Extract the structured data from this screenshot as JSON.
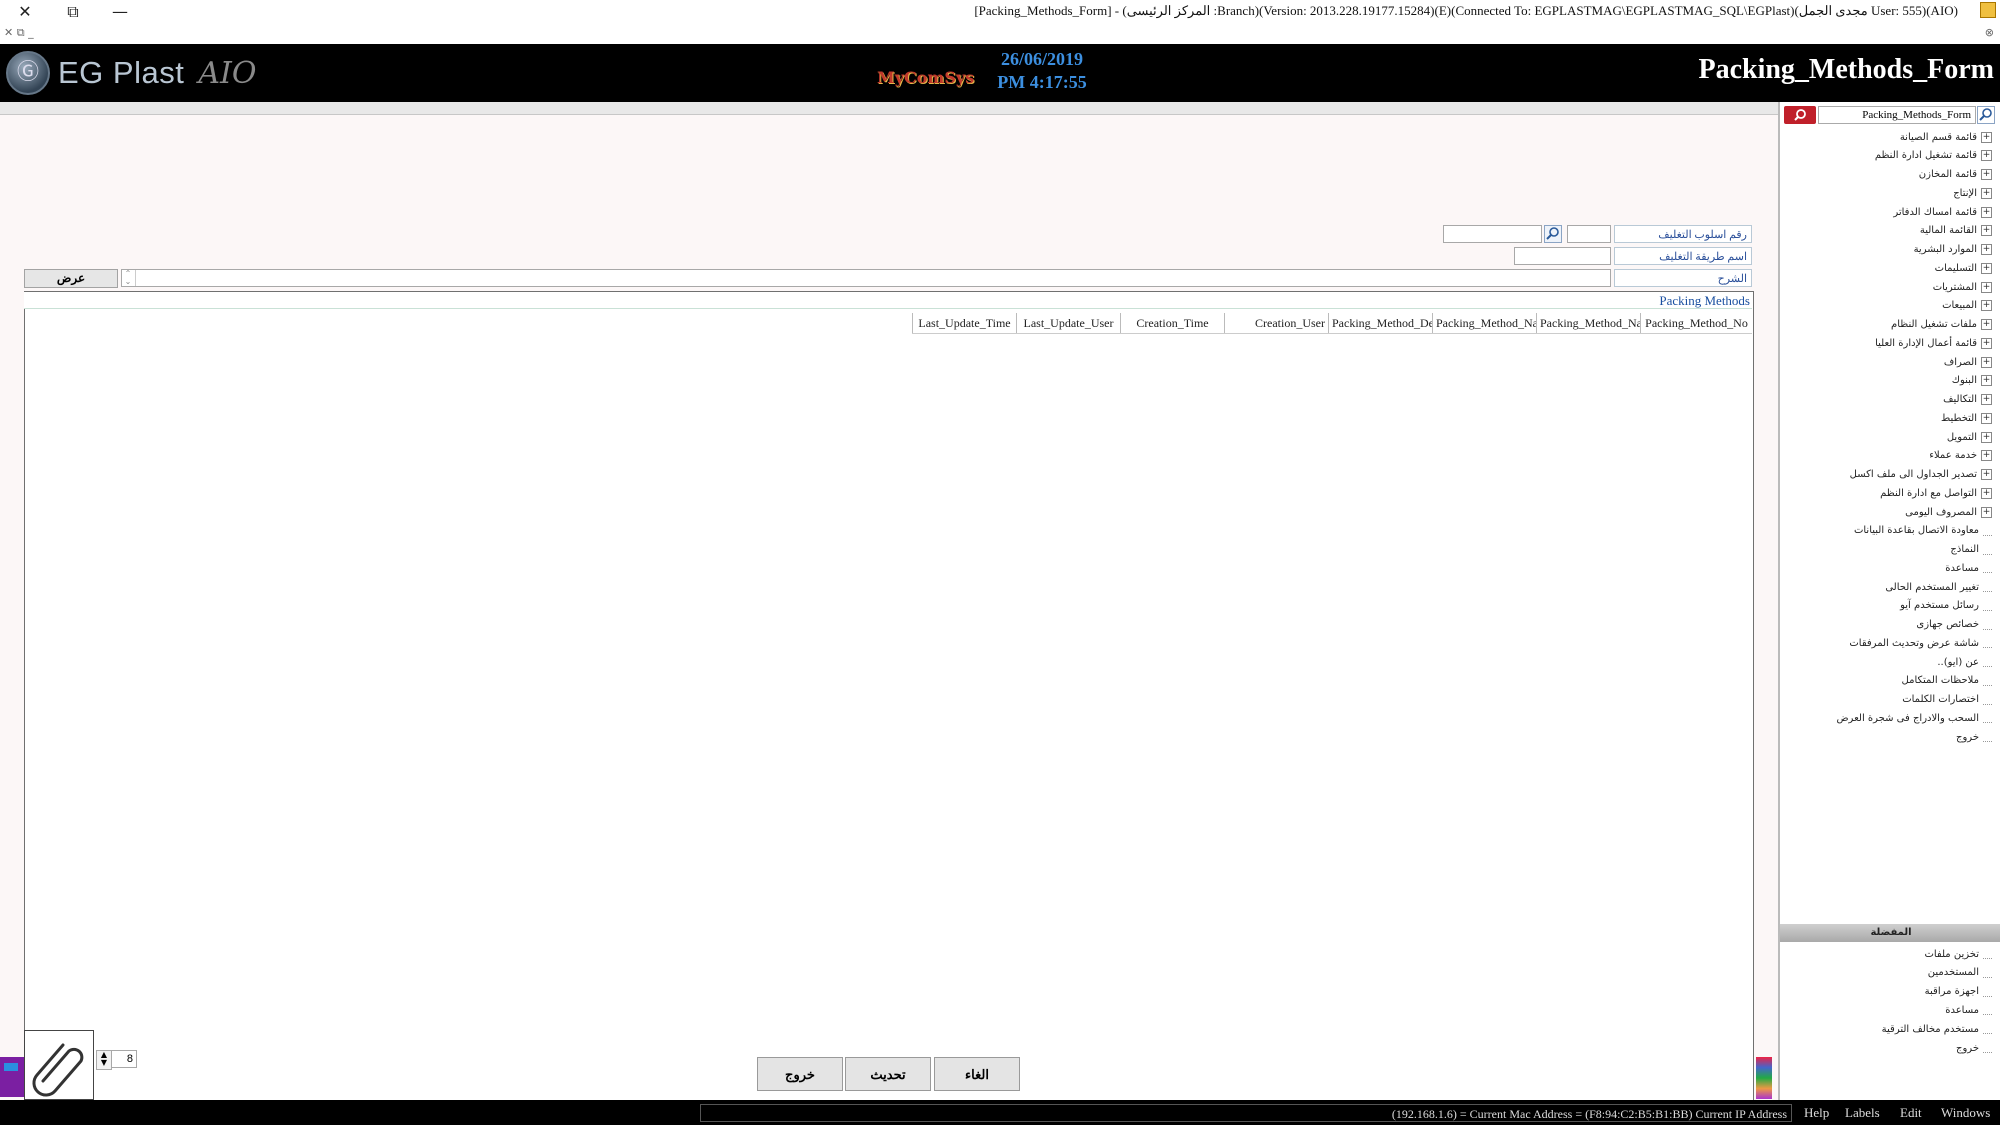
{
  "window": {
    "title": "[Packing_Methods_Form] - (المركز الرئيسى :Branch)(Version: 2013.228.19177.15284)(E)(Connected To: EGPLASTMAG\\EGPLASTMAG_SQL\\EGPlast)(مجدى الجمل User: 555)(AIO)",
    "close_glyph": "✕",
    "restore_glyph": "⧉",
    "minimize_glyph": "—",
    "mdi_controls": "✕ ⧉ _",
    "mdi_right": "⊗"
  },
  "header": {
    "brand_name": "EG Plast",
    "brand_suffix": "AIO",
    "logo_glyph": "Ⓖ",
    "company_mark": "MyComSys",
    "date": "26/06/2019",
    "time": "PM 4:17:55",
    "form_title": "Packing_Methods_Form"
  },
  "form": {
    "label_method_no": "رقم اسلوب التغليف",
    "label_method_name": "اسم طريقة التغليف",
    "label_description": "الشرح",
    "method_no_value": "",
    "method_name_value": "",
    "description_value": "",
    "show_button": "عرض"
  },
  "grid": {
    "caption": "Packing Methods",
    "columns": [
      "Packing_Method_No",
      "Packing_Method_Name",
      "Packing_Method_Name",
      "Packing_Method_Description",
      "Creation_User",
      "Creation_Time",
      "Last_Update_User",
      "Last_Update_Time"
    ]
  },
  "footer": {
    "cancel_button": "الغاء",
    "update_button": "تحديث",
    "exit_button": "خروج",
    "attachment_count": "8"
  },
  "sidebar": {
    "search_value": "Packing_Methods_Form",
    "tree": [
      {
        "label": "قائمة قسم الصيانة",
        "expandable": true
      },
      {
        "label": "قائمة تشغيل ادارة النظم",
        "expandable": true
      },
      {
        "label": "قائمة المخازن",
        "expandable": true
      },
      {
        "label": "الإنتاج",
        "expandable": true
      },
      {
        "label": "قائمة امساك الدفاتر",
        "expandable": true
      },
      {
        "label": "القائمة المالية",
        "expandable": true
      },
      {
        "label": "الموارد البشرية",
        "expandable": true
      },
      {
        "label": "التسليمات",
        "expandable": true
      },
      {
        "label": "المشتريات",
        "expandable": true
      },
      {
        "label": "المبيعات",
        "expandable": true
      },
      {
        "label": "ملفات تشغيل النظام",
        "expandable": true
      },
      {
        "label": "قائمة أعمال الإدارة العليا",
        "expandable": true
      },
      {
        "label": "الصراف",
        "expandable": true
      },
      {
        "label": "البنوك",
        "expandable": true
      },
      {
        "label": "التكاليف",
        "expandable": true
      },
      {
        "label": "التخطيط",
        "expandable": true
      },
      {
        "label": "التمويل",
        "expandable": true
      },
      {
        "label": "خدمة عملاء",
        "expandable": true
      },
      {
        "label": "تصدير الجداول الى ملف اكسل",
        "expandable": true
      },
      {
        "label": "التواصل مع ادارة النظم",
        "expandable": true
      },
      {
        "label": "المصروف اليومى",
        "expandable": true
      },
      {
        "label": "معاودة الاتصال بقاعدة البيانات",
        "expandable": false
      },
      {
        "label": "النماذج",
        "expandable": false
      },
      {
        "label": "مساعدة",
        "expandable": false
      },
      {
        "label": "تغيير المستخدم الحالى",
        "expandable": false
      },
      {
        "label": "رسائل مستخدم آيو",
        "expandable": false
      },
      {
        "label": "خصائص جهازى",
        "expandable": false
      },
      {
        "label": "شاشة عرض وتحديث المرفقات",
        "expandable": false
      },
      {
        "label": "عن (ايو)..",
        "expandable": false
      },
      {
        "label": "ملاحظات المتكامل",
        "expandable": false
      },
      {
        "label": "اختصارات الكلمات",
        "expandable": false
      },
      {
        "label": "السحب والادراج فى شجرة العرض",
        "expandable": false
      },
      {
        "label": "خروج",
        "expandable": false
      }
    ],
    "favorites_title": "المفضلة",
    "favorites": [
      "تخزين ملفات",
      "المستخدمين",
      "اجهزة مراقبة",
      "مساعدة",
      "مستخدم مخالف الترقية",
      "خروج"
    ]
  },
  "statusbar": {
    "text": "(192.168.1.6) = Current Mac Address = (F8:94:C2:B5:B1:BB) Current IP Address",
    "menus": [
      "Help",
      "Labels",
      "Edit",
      "Windows"
    ]
  },
  "colors": {
    "header_bg": "#000000",
    "clock": "#3c8fe0",
    "label_text": "#2a4f9a",
    "search_red": "#c0202a"
  }
}
